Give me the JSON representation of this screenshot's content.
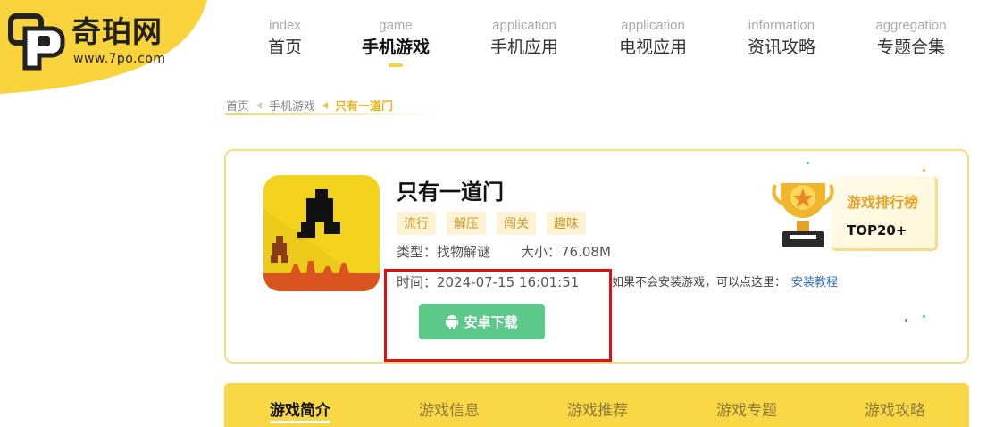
{
  "logo": {
    "name": "奇珀网",
    "url": "www.7po.com",
    "accent": "#f9d33c"
  },
  "nav": [
    {
      "en": "index",
      "cn": "首页",
      "active": false
    },
    {
      "en": "game",
      "cn": "手机游戏",
      "active": true
    },
    {
      "en": "application",
      "cn": "手机应用",
      "active": false
    },
    {
      "en": "application",
      "cn": "电视应用",
      "active": false
    },
    {
      "en": "information",
      "cn": "资讯攻略",
      "active": false
    },
    {
      "en": "aggregation",
      "cn": "专题合集",
      "active": false
    }
  ],
  "breadcrumb": {
    "home": "首页",
    "category": "手机游戏",
    "current": "只有一道门"
  },
  "game": {
    "title": "只有一道门",
    "tags": [
      "流行",
      "解压",
      "闯关",
      "趣味"
    ],
    "type_label": "类型：找物解谜",
    "size_label": "大小：76.08M",
    "time_label": "时间：2024-07-15 16:01:51",
    "install_hint": "如果不会安装游戏，可以点这里：",
    "install_link": "安装教程",
    "download_label": "安卓下载",
    "icon_name": "game-app-icon"
  },
  "ranking": {
    "title": "游戏排行榜",
    "subtitle": "TOP20+"
  },
  "tabs": [
    {
      "label": "游戏简介",
      "active": true
    },
    {
      "label": "游戏信息",
      "active": false
    },
    {
      "label": "游戏推荐",
      "active": false
    },
    {
      "label": "游戏专题",
      "active": false
    },
    {
      "label": "游戏攻略",
      "active": false
    }
  ],
  "colors": {
    "brand_yellow": "#fad845",
    "download_green": "#5cc98a",
    "highlight_red": "#e01010"
  }
}
